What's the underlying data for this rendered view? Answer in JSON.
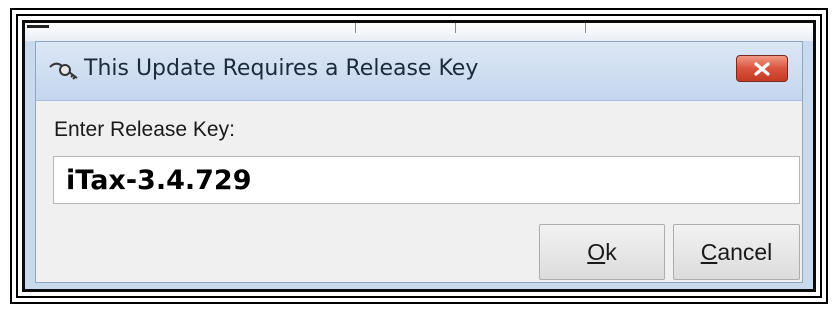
{
  "dialog": {
    "title": "This Update Requires a Release Key",
    "title_icon": "key-icon",
    "close_icon": "close-icon",
    "prompt_label": "Enter Release Key:",
    "release_key_value": "iTax-3.4.729",
    "ok": {
      "mnemonic": "O",
      "rest": "k"
    },
    "cancel": {
      "mnemonic": "C",
      "rest": "ancel"
    }
  },
  "colors": {
    "close_button": "#d9533c",
    "titlebar": "#c4d6ee",
    "dialog_background": "#f0f0f0"
  }
}
